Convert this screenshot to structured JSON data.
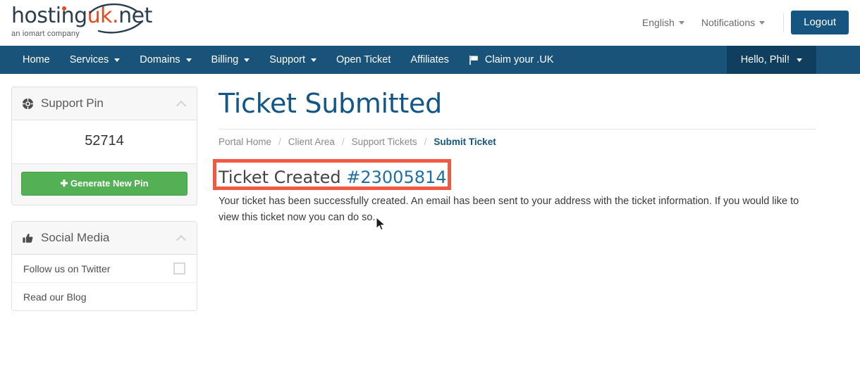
{
  "brand": {
    "logo_text_main": "hosting",
    "logo_text_accent": "uk",
    "logo_text_dot": ".",
    "logo_text_tld": "net",
    "tagline": "an iomart company",
    "accent_color": "#e8491d",
    "navy_color": "#2b3e50"
  },
  "header": {
    "language": "English",
    "notifications": "Notifications",
    "logout": "Logout",
    "logout_bg": "#15557f"
  },
  "nav": {
    "bar_color": "#1a5379",
    "user_box_color": "#0f3e5e",
    "items": [
      {
        "label": "Home",
        "caret": false
      },
      {
        "label": "Services",
        "caret": true
      },
      {
        "label": "Domains",
        "caret": true
      },
      {
        "label": "Billing",
        "caret": true
      },
      {
        "label": "Support",
        "caret": true
      },
      {
        "label": "Open Ticket",
        "caret": false
      },
      {
        "label": "Affiliates",
        "caret": false
      },
      {
        "label": "Claim your .UK",
        "caret": false,
        "icon": "flag-icon"
      }
    ],
    "user_greeting": "Hello, Phil!"
  },
  "sidebar": {
    "support_pin": {
      "title": "Support Pin",
      "icon": "lifebuoy-icon",
      "pin": "52714",
      "generate_button": "Generate New Pin",
      "button_color": "#54b054"
    },
    "social_media": {
      "title": "Social Media",
      "icon": "thumbs-up-icon",
      "items": [
        {
          "label": "Follow us on Twitter",
          "trailing_icon": "twitter-square-icon"
        },
        {
          "label": "Read our Blog",
          "trailing_icon": ""
        }
      ]
    }
  },
  "main": {
    "page_title": "Ticket Submitted",
    "title_color": "#125687",
    "breadcrumb": [
      {
        "label": "Portal Home",
        "active": false
      },
      {
        "label": "Client Area",
        "active": false
      },
      {
        "label": "Support Tickets",
        "active": false
      },
      {
        "label": "Submit Ticket",
        "active": true
      }
    ],
    "breadcrumb_separator": "/",
    "ticket_created_label": "Ticket Created",
    "ticket_number": "#23005814",
    "ticket_number_color": "#1d6fa5",
    "body_text": "Your ticket has been successfully created. An email has been sent to your address with the ticket information. If you would like to view this ticket now you can do so.",
    "highlight_color": "#f05a42"
  }
}
